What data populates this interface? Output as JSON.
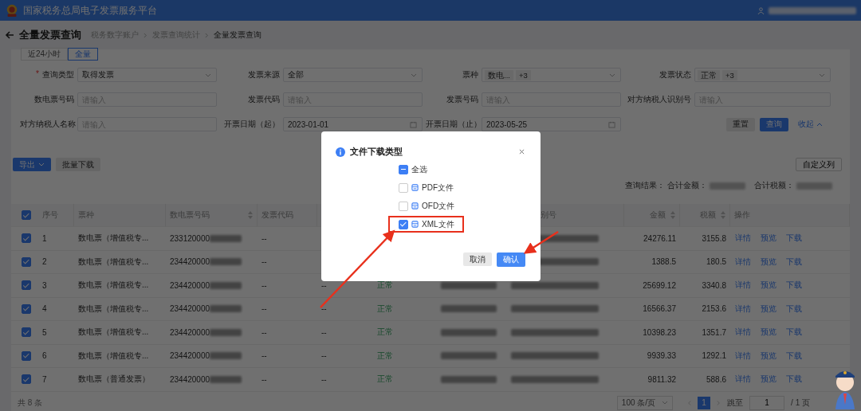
{
  "header": {
    "title": "国家税务总局电子发票服务平台"
  },
  "page": {
    "title": "全量发票查询",
    "breadcrumb": [
      "税务数字账户",
      "发票查询统计",
      "全量发票查询"
    ]
  },
  "tabs": [
    {
      "label": "近24小时",
      "selected": false
    },
    {
      "label": "全量",
      "selected": true
    }
  ],
  "filters": [
    {
      "label": "查询类型",
      "required_mark": "*",
      "kind": "select",
      "value": "取得发票"
    },
    {
      "label": "发票来源",
      "kind": "select",
      "value": "全部"
    },
    {
      "label": "票种",
      "kind": "tags",
      "tags": [
        "数电...",
        "+3"
      ]
    },
    {
      "label": "发票状态",
      "kind": "tags",
      "tags": [
        "正常",
        "+3"
      ]
    },
    {
      "label": "数电票号码",
      "kind": "input",
      "placeholder": "请输入"
    },
    {
      "label": "发票代码",
      "kind": "input",
      "placeholder": "请输入"
    },
    {
      "label": "发票号码",
      "kind": "input",
      "placeholder": "请输入"
    },
    {
      "label": "对方纳税人识别号",
      "kind": "input",
      "placeholder": "请输入"
    },
    {
      "label": "对方纳税人名称",
      "kind": "input",
      "placeholder": "请输入"
    },
    {
      "label": "开票日期（起）",
      "kind": "date",
      "value": "2023-01-01"
    },
    {
      "label": "开票日期（止）",
      "kind": "date",
      "value": "2023-05-25"
    }
  ],
  "filter_actions": {
    "reset": "重置",
    "search": "查询",
    "collapse": "收起"
  },
  "toolbar": {
    "export": "导出",
    "batch_download": "批量下载",
    "custom_columns": "自定义列"
  },
  "summary": {
    "label": "查询结果：",
    "total_amount_label": "合计金额：",
    "total_tax_label": "合计税额："
  },
  "table": {
    "all_selected": true,
    "columns": [
      {
        "label": "序号",
        "sortable": false
      },
      {
        "label": "票种",
        "sortable": false
      },
      {
        "label": "数电票号码",
        "sortable": true
      },
      {
        "label": "发票代码",
        "sortable": false
      },
      {
        "label": "别号",
        "sortable": false
      },
      {
        "label": "金额",
        "sortable": true
      },
      {
        "label": "税额",
        "sortable": true
      },
      {
        "label": "操作",
        "sortable": false
      }
    ],
    "rows": [
      {
        "selected": true,
        "index": "1",
        "type": "数电票（增值税专...",
        "number": "233120000",
        "code": "--",
        "amount": "24276.11",
        "tax": "3155.8",
        "actions": [
          "详情",
          "预览",
          "下载"
        ]
      },
      {
        "selected": true,
        "index": "2",
        "type": "数电票（增值税专...",
        "number": "234420000",
        "code": "--",
        "amount": "1388.5",
        "tax": "180.5",
        "actions": [
          "详情",
          "预览",
          "下载"
        ]
      },
      {
        "selected": true,
        "index": "3",
        "type": "数电票（增值税专...",
        "number": "234420000",
        "code": "--",
        "column_6": "--",
        "status": "正常",
        "amount": "25699.12",
        "tax": "3340.8",
        "actions": [
          "详情",
          "预览",
          "下载"
        ]
      },
      {
        "selected": true,
        "index": "4",
        "type": "数电票（增值税专...",
        "number": "234420000",
        "code": "--",
        "column_6": "--",
        "status": "正常",
        "amount": "16566.37",
        "tax": "2153.6",
        "actions": [
          "详情",
          "预览",
          "下载"
        ]
      },
      {
        "selected": true,
        "index": "5",
        "type": "数电票（增值税专...",
        "number": "234420000",
        "code": "--",
        "column_6": "--",
        "status": "正常",
        "amount": "10398.23",
        "tax": "1351.7",
        "actions": [
          "详情",
          "预览",
          "下载"
        ]
      },
      {
        "selected": true,
        "index": "6",
        "type": "数电票（增值税专...",
        "number": "234420000",
        "code": "--",
        "column_6": "--",
        "status": "正常",
        "amount": "9939.33",
        "tax": "1292.1",
        "actions": [
          "详情",
          "预览",
          "下载"
        ]
      },
      {
        "selected": true,
        "index": "7",
        "type": "数电票（普通发票）",
        "number": "234420000",
        "code": "--",
        "column_6": "--",
        "status": "正常",
        "amount": "9811.32",
        "tax": "588.6",
        "actions": [
          "详情",
          "预览",
          "下载"
        ]
      }
    ]
  },
  "pagination": {
    "total": "共 8 条",
    "page_size": "100 条/页",
    "pages": [
      {
        "label": "1",
        "selected": true
      }
    ],
    "jump_label": "跳至",
    "jump_value": "1",
    "page_count": "/ 1 页"
  },
  "dialog": {
    "title": "文件下载类型",
    "options": [
      {
        "label": "全选",
        "kind": "select_all",
        "indeterminate": true,
        "highlighted": false
      },
      {
        "label": "PDF文件",
        "kind": "file",
        "checked": false,
        "highlighted": false
      },
      {
        "label": "OFD文件",
        "kind": "file",
        "checked": false,
        "highlighted": false
      },
      {
        "label": "XML文件",
        "kind": "file",
        "checked": true,
        "highlighted": true
      }
    ],
    "cancel": "取消",
    "confirm": "确认"
  }
}
